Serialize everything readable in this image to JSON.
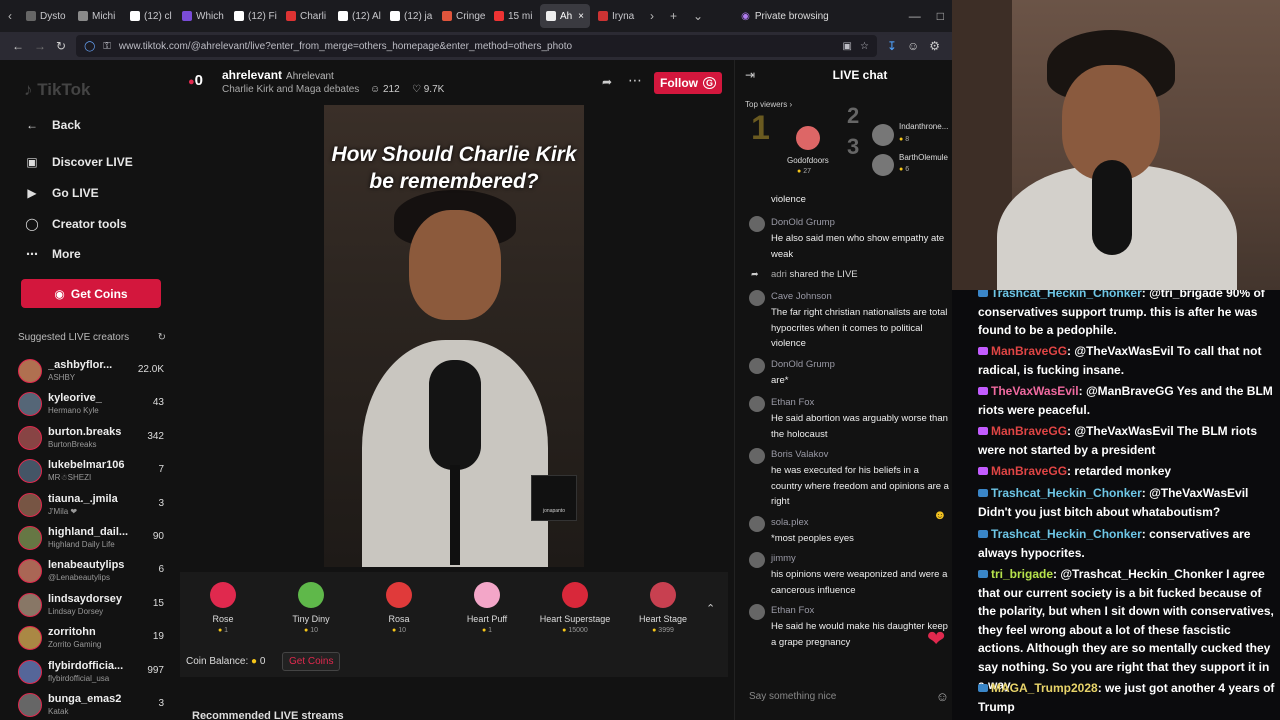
{
  "browser": {
    "tabs": [
      {
        "label": "Dysto",
        "color": "#666"
      },
      {
        "label": "Michi",
        "color": "#8a8a8a"
      },
      {
        "label": "(12) cl",
        "color": "#ffffff"
      },
      {
        "label": "Which",
        "color": "#7a4cd8"
      },
      {
        "label": "(12) Fi",
        "color": "#ffffff"
      },
      {
        "label": "Charli",
        "color": "#d33"
      },
      {
        "label": "(12) Al",
        "color": "#ffffff"
      },
      {
        "label": "(12) ja",
        "color": "#ffffff"
      },
      {
        "label": "Cringe",
        "color": "#e0553c"
      },
      {
        "label": "15 mi",
        "color": "#e33"
      },
      {
        "label": "Ah",
        "color": "#eee"
      },
      {
        "label": "Iryna",
        "color": "#c33"
      }
    ],
    "private_label": "Private browsing",
    "url": "www.tiktok.com/@ahrelevant/live?enter_from_merge=others_homepage&enter_method=others_photo"
  },
  "sidebar": {
    "logo": "TikTok",
    "back": "Back",
    "discover": "Discover LIVE",
    "go_live": "Go LIVE",
    "creator_tools": "Creator tools",
    "more": "More",
    "get_coins": "Get Coins",
    "suggested_title": "Suggested LIVE creators",
    "creators": [
      {
        "name": "_ashbyflor...",
        "sub": "ASHBY",
        "count": "22.0K",
        "color": "#b07050"
      },
      {
        "name": "kyleorive_",
        "sub": "Hermano Kyle",
        "count": "43",
        "color": "#556677"
      },
      {
        "name": "burton.breaks",
        "sub": "BurtonBreaks",
        "count": "342",
        "color": "#884444"
      },
      {
        "name": "lukebelmar106",
        "sub": "MR☃SHEZI",
        "count": "7",
        "color": "#445566"
      },
      {
        "name": "tiauna._.jmila",
        "sub": "J'Mila ❤",
        "count": "3",
        "color": "#775544"
      },
      {
        "name": "highland_dail...",
        "sub": "Highland Daily Life",
        "count": "90",
        "color": "#667744"
      },
      {
        "name": "lenabeautylips",
        "sub": "@Lenabeautylips",
        "count": "6",
        "color": "#aa6655"
      },
      {
        "name": "lindsaydorsey",
        "sub": "Lindsay Dorsey",
        "count": "15",
        "color": "#887766"
      },
      {
        "name": "zorritohn",
        "sub": "Zorrito Gaming",
        "count": "19",
        "color": "#aa8844"
      },
      {
        "name": "flybirdofficia...",
        "sub": "flybirdofficial_usa",
        "count": "997",
        "color": "#556699"
      },
      {
        "name": "bunga_emas2",
        "sub": "Katak",
        "count": "3",
        "color": "#666666"
      }
    ]
  },
  "stream": {
    "badge": "0",
    "name": "ahrelevant",
    "handle": "Ahrelevant",
    "category": "Charlie Kirk and Maga debates",
    "viewers": "212",
    "likes": "9.7K",
    "follow": "Follow",
    "video_title": "How Should Charlie Kirk be remembered?",
    "pip_name": "jonapanto",
    "gifts": [
      {
        "name": "Rose",
        "price": "1",
        "color": "#e0294e"
      },
      {
        "name": "Tiny Diny",
        "price": "10",
        "color": "#5fb84a"
      },
      {
        "name": "Rosa",
        "price": "10",
        "color": "#e03a3a"
      },
      {
        "name": "Heart Puff",
        "price": "1",
        "color": "#f3a6c8"
      },
      {
        "name": "Heart Superstage",
        "price": "15000",
        "color": "#d8283a"
      },
      {
        "name": "Heart Stage",
        "price": "3999",
        "color": "#c84050"
      }
    ],
    "coin_balance_label": "Coin Balance:",
    "coin_balance": "0",
    "get_coins": "Get Coins",
    "recommended": "Recommended LIVE streams"
  },
  "live_chat": {
    "title": "LIVE chat",
    "top_viewers_label": "Top viewers",
    "top": [
      {
        "rank": "1",
        "name": "Godofdoors",
        "coins": "27"
      },
      {
        "rank": "2",
        "name": "Indanthrone...",
        "coins": "8"
      },
      {
        "rank": "3",
        "name": "BarthOlemule",
        "coins": "6"
      }
    ],
    "partial": "violence",
    "messages": [
      {
        "user": "DonOld Grump",
        "text": "He also said men who show empathy ate weak"
      },
      {
        "user": "adri",
        "text": "shared the LIVE"
      },
      {
        "user": "Cave Johnson",
        "text": "The far right christian nationalists are total hypocrites when it comes to political violence"
      },
      {
        "user": "DonOld Grump",
        "text": "are*"
      },
      {
        "user": "Ethan Fox",
        "text": "He said abortion was arguably worse than the holocaust"
      },
      {
        "user": "Boris Valakov",
        "text": "he was executed for his beliefs in a country where freedom and opinions are a right"
      },
      {
        "user": "sola.plex",
        "text": "*most peoples eyes"
      },
      {
        "user": "jimmy",
        "text": "his opinions were weaponized and were a cancerous influence"
      },
      {
        "user": "Ethan Fox",
        "text": "He said he would make his daughter keep a grape pregnancy"
      }
    ],
    "input_placeholder": "Say something nice"
  },
  "twitch_chat": [
    {
      "user": "Trashcat_Heckin_Chonker",
      "text": ": @tri_brigade 90% of conservatives support trump. this is after he was found to be a pedophile."
    },
    {
      "user": "ManBraveGG",
      "text": ": @TheVaxWasEvil To call that not radical, is fucking insane."
    },
    {
      "user": "TheVaxWasEvil",
      "text": ": @ManBraveGG Yes and the BLM riots were peaceful."
    },
    {
      "user": "ManBraveGG",
      "text": ": @TheVaxWasEvil The BLM riots were not started by a president"
    },
    {
      "user": "ManBraveGG",
      "text": ": retarded monkey"
    },
    {
      "user": "Trashcat_Heckin_Chonker",
      "text": ": @TheVaxWasEvil Didn't you just bitch about whataboutism?"
    },
    {
      "user": "Trashcat_Heckin_Chonker",
      "text": ": conservatives are always hypocrites."
    },
    {
      "user": "tri_brigade",
      "text": ": @Trashcat_Heckin_Chonker I agree that our current society is a bit fucked because of the polarity, but when I sit down with conservatives, they feel wrong about a lot of these fascistic actions. Although they are so mentally cucked they say nothing. So you are right that they support it in a way"
    },
    {
      "user": "MAGA_Trump2028",
      "text": ": we just got another 4 years of Trump"
    }
  ]
}
